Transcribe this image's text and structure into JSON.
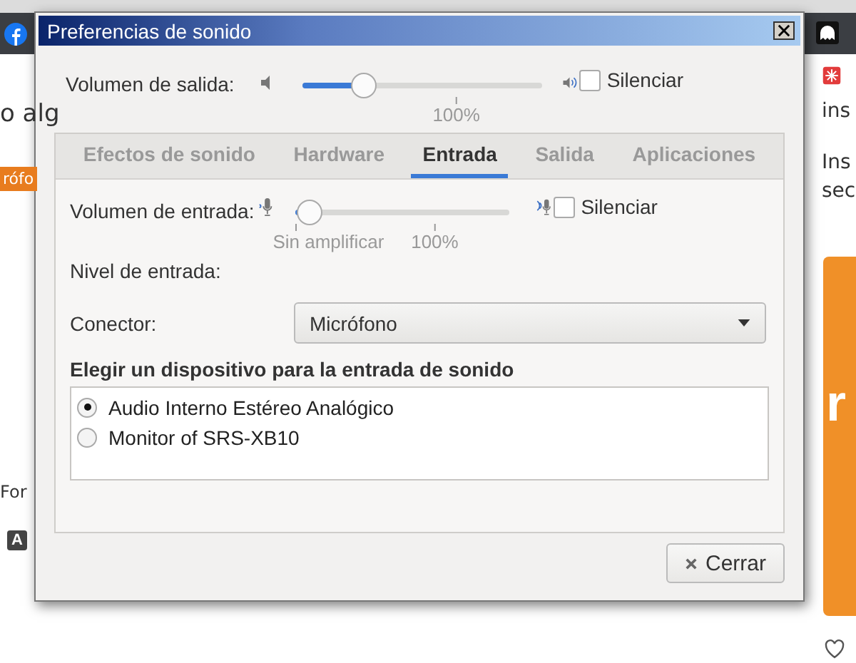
{
  "background": {
    "left": [
      {
        "kind": "text",
        "text": "o alg"
      },
      {
        "kind": "tag",
        "text": "rófo"
      },
      {
        "kind": "text",
        "text": "For"
      },
      {
        "kind": "key",
        "text": "A"
      }
    ],
    "right": [
      {
        "kind": "text",
        "text": "ins"
      },
      {
        "kind": "text",
        "text": "Ins"
      },
      {
        "kind": "text",
        "text": "sec"
      },
      {
        "kind": "banner",
        "text": "r"
      }
    ]
  },
  "window": {
    "title": "Preferencias de sonido"
  },
  "output_volume": {
    "label": "Volumen de salida:",
    "level": 0.23,
    "marks": [
      {
        "label": "100%"
      }
    ],
    "mute": {
      "label": "Silenciar",
      "checked": false
    }
  },
  "tabs": [
    {
      "label": "Efectos de sonido",
      "selected": false
    },
    {
      "label": "Hardware",
      "selected": false
    },
    {
      "label": "Entrada",
      "selected": true
    },
    {
      "label": "Salida",
      "selected": false
    },
    {
      "label": "Aplicaciones",
      "selected": false
    }
  ],
  "input_volume": {
    "label": "Volumen de entrada:",
    "level": 0.06,
    "marks": [
      {
        "label": "Sin amplificar"
      },
      {
        "label": "100%"
      }
    ],
    "mute": {
      "label": "Silenciar",
      "checked": false
    }
  },
  "input_level": {
    "label": "Nivel de entrada:"
  },
  "connector": {
    "label": "Conector:",
    "value": "Micrófono"
  },
  "devices": {
    "heading": "Elegir un dispositivo para la entrada de sonido",
    "items": [
      {
        "label": "Audio Interno Estéreo Analógico",
        "selected": true
      },
      {
        "label": "Monitor of SRS-XB10",
        "selected": false
      }
    ]
  },
  "buttons": [
    {
      "label": "Cerrar"
    }
  ]
}
